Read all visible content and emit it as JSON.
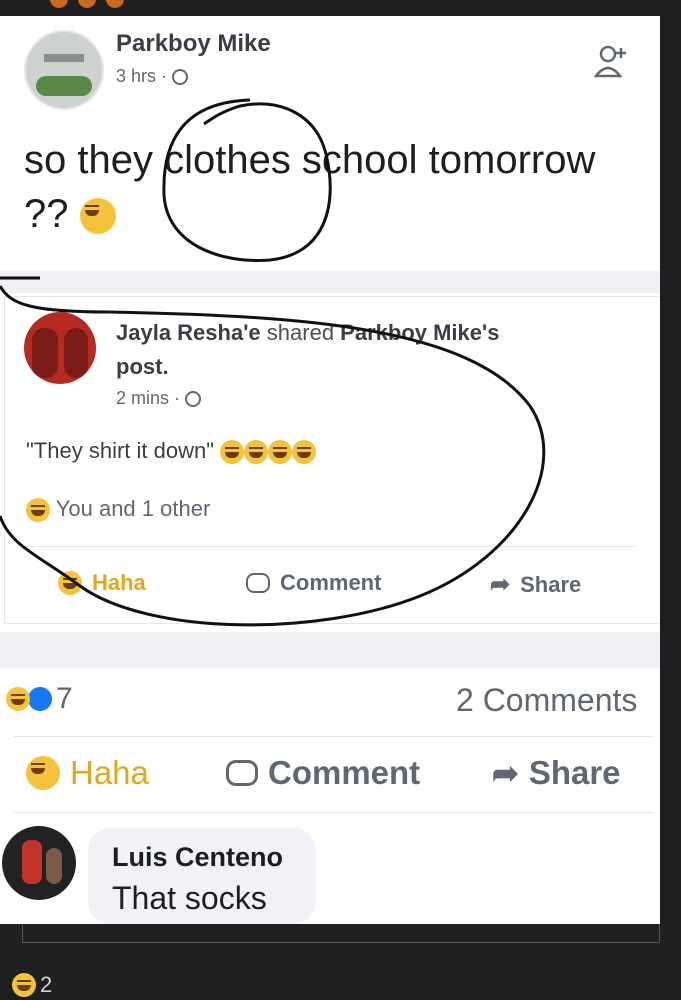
{
  "original_post": {
    "author": "Parkboy Mike",
    "time": "3 hrs ·",
    "text_line1": "so they clothes school tomorrow",
    "text_line2": "??"
  },
  "shared_post": {
    "author": "Jayla Resha'e",
    "shared_text": " shared ",
    "original_author_possessive": "Parkboy Mike's",
    "post_word": "post.",
    "time": "2 mins ·",
    "quote": "\"They shirt it down\"",
    "reactions_text": "You and 1 other",
    "actions": {
      "haha": "Haha",
      "comment": "Comment",
      "share": "Share"
    }
  },
  "stats": {
    "reaction_count": "7",
    "comments_count": "2 Comments"
  },
  "actions": {
    "haha": "Haha",
    "comment": "Comment",
    "share": "Share"
  },
  "comment": {
    "author": "Luis Centeno",
    "text": "That socks"
  },
  "footer": {
    "reaction_count": "2"
  },
  "colors": {
    "haha_yellow": "#f5c33b",
    "like_blue": "#1877f2",
    "text": "#1c1e21",
    "secondary": "#606770"
  }
}
